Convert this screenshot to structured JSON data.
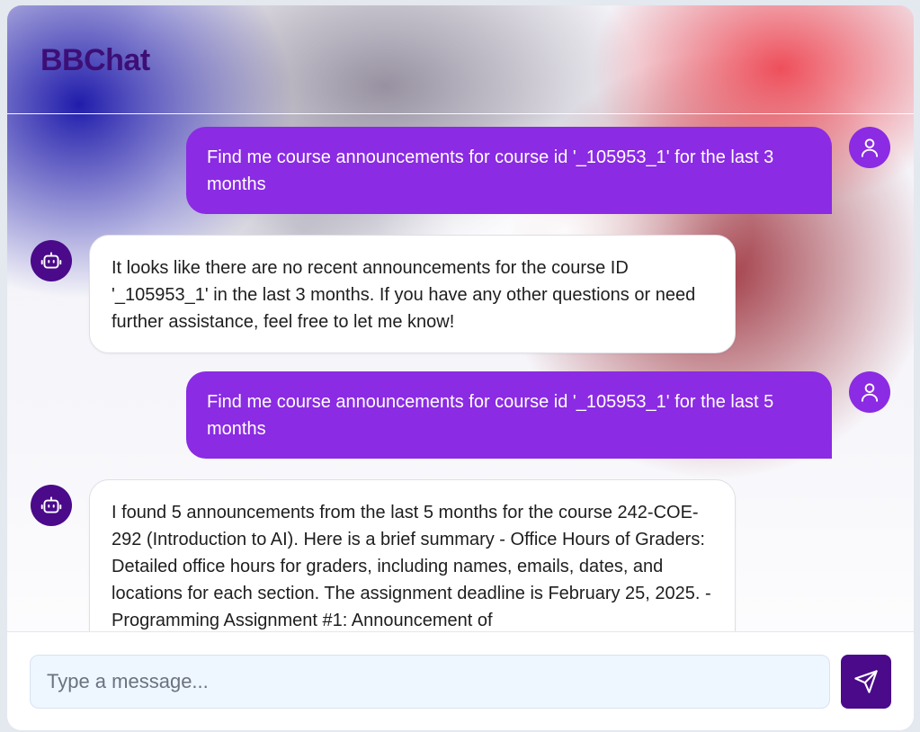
{
  "app": {
    "title": "BBChat"
  },
  "messages": [
    {
      "role": "user",
      "text": "Find me course announcements for course id '_105953_1' for the last 3 months"
    },
    {
      "role": "bot",
      "text": "It looks like there are no recent announcements for the course ID '_105953_1' in the last 3 months. If you have any other questions or need further assistance, feel free to let me know!"
    },
    {
      "role": "user",
      "text": "Find me course announcements for course id '_105953_1' for the last 5 months"
    },
    {
      "role": "bot",
      "text": "I found 5 announcements from the last 5 months for the course 242-COE-292 (Introduction to AI). Here is a brief summary - Office Hours of Graders: Detailed office hours for graders, including names, emails, dates, and locations for each section. The assignment deadline is February 25, 2025. - Programming Assignment #1: Announcement of"
    }
  ],
  "composer": {
    "placeholder": "Type a message...",
    "value": ""
  },
  "icons": {
    "user_avatar": "user-icon",
    "bot_avatar": "robot-icon",
    "send": "send-icon"
  },
  "colors": {
    "user_bubble": "#8b2be3",
    "bot_avatar": "#4a0a8a",
    "title": "#3d0f76",
    "send_button": "#4a0a8a"
  }
}
